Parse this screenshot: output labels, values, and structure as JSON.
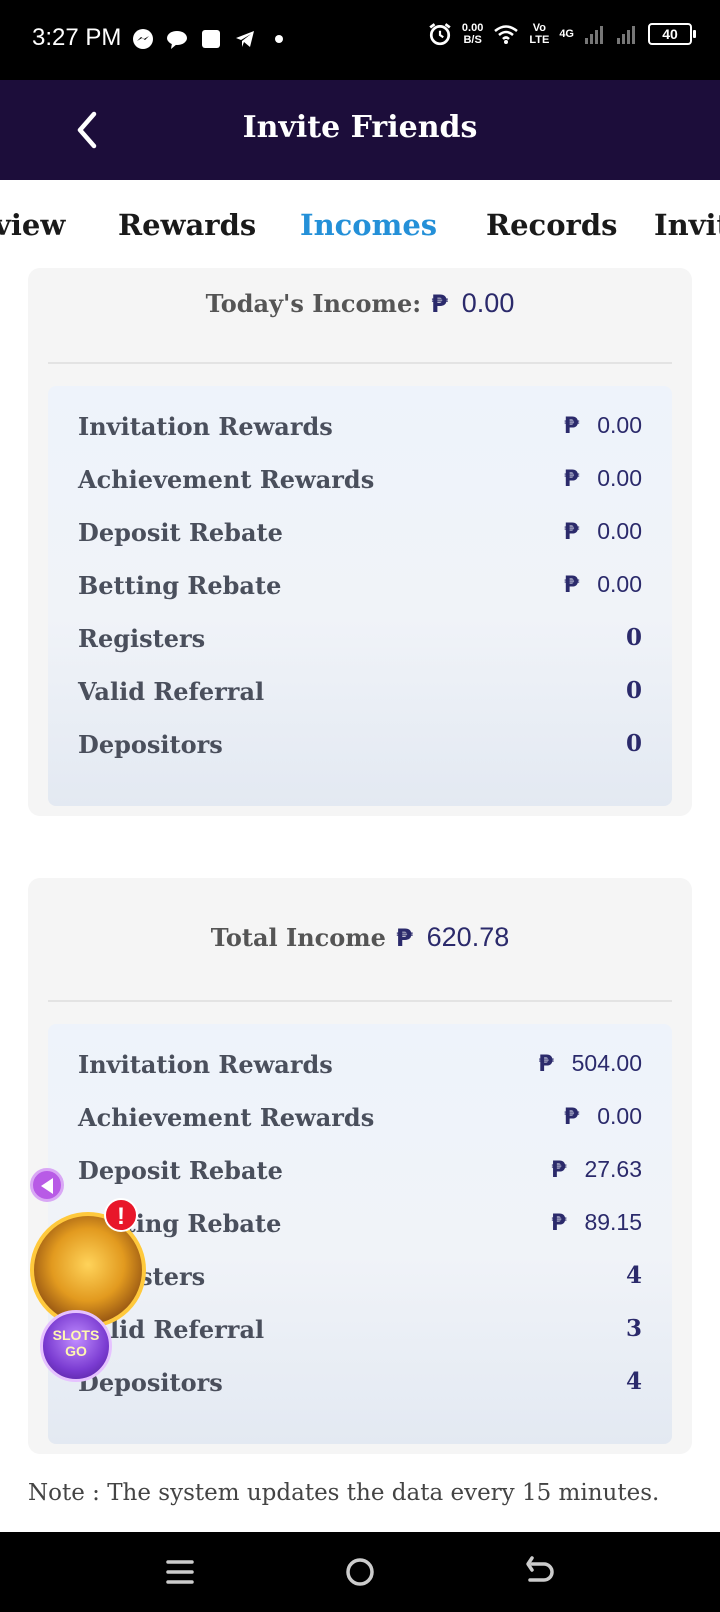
{
  "status_bar": {
    "time": "3:27 PM",
    "net_speed_value": "0.00",
    "net_speed_unit": "B/S",
    "volte_top": "Vo",
    "volte_bottom": "LTE",
    "network": "4G",
    "battery": "40"
  },
  "header": {
    "title": "Invite Friends"
  },
  "tabs": [
    {
      "label": "view"
    },
    {
      "label": "Rewards"
    },
    {
      "label": "Incomes"
    },
    {
      "label": "Records"
    },
    {
      "label": "Invit"
    }
  ],
  "currency_symbol": "₱",
  "today": {
    "label": "Today's Income:",
    "amount": "0.00",
    "rows": [
      {
        "label": "Invitation Rewards",
        "value": "0.00"
      },
      {
        "label": "Achievement Rewards",
        "value": "0.00"
      },
      {
        "label": "Deposit Rebate",
        "value": "0.00"
      },
      {
        "label": "Betting Rebate",
        "value": "0.00"
      },
      {
        "label": "Registers",
        "value": "0"
      },
      {
        "label": "Valid Referral",
        "value": "0"
      },
      {
        "label": "Depositors",
        "value": "0"
      }
    ]
  },
  "total": {
    "label": "Total Income",
    "amount": "620.78",
    "rows": [
      {
        "label": "Invitation Rewards",
        "value": "504.00"
      },
      {
        "label": "Achievement Rewards",
        "value": "0.00"
      },
      {
        "label": "Deposit Rebate",
        "value": "27.63"
      },
      {
        "label": "Betting Rebate",
        "value": "89.15"
      },
      {
        "label": "Registers",
        "value": "4"
      },
      {
        "label": "Valid Referral",
        "value": "3"
      },
      {
        "label": "Depositors",
        "value": "4"
      }
    ]
  },
  "note": "Note : The system updates the data every 15 minutes.",
  "floating": {
    "badge": "!",
    "slots_label": "SLOTS GO"
  },
  "colors": {
    "header_bg": "#1c0d3a",
    "active_tab": "#2490d8",
    "amount_text": "#2b2a6b"
  }
}
